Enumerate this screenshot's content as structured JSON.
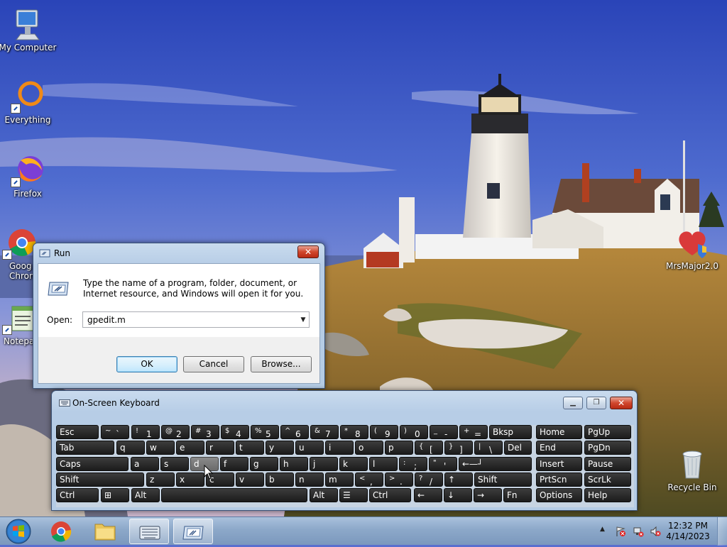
{
  "desktop": {
    "icons": [
      {
        "label": "My Computer"
      },
      {
        "label": "Everything"
      },
      {
        "label": "Firefox"
      },
      {
        "label": "Goog… Chrom…"
      },
      {
        "label": "Notepa…"
      },
      {
        "label": "MrsMajor2.0"
      },
      {
        "label": "Recycle Bin"
      }
    ]
  },
  "run_dialog": {
    "title": "Run",
    "description": "Type the name of a program, folder, document, or Internet resource, and Windows will open it for you.",
    "open_label": "Open:",
    "open_value": "gpedit.m",
    "ok_label": "OK",
    "cancel_label": "Cancel",
    "browse_label": "Browse..."
  },
  "osk": {
    "title": "On-Screen Keyboard",
    "rows": [
      [
        {
          "label": "Esc"
        },
        {
          "shift": "~",
          "main": "`"
        },
        {
          "shift": "!",
          "main": "1"
        },
        {
          "shift": "@",
          "main": "2"
        },
        {
          "shift": "#",
          "main": "3"
        },
        {
          "shift": "$",
          "main": "4"
        },
        {
          "shift": "%",
          "main": "5"
        },
        {
          "shift": "^",
          "main": "6"
        },
        {
          "shift": "&",
          "main": "7"
        },
        {
          "shift": "*",
          "main": "8"
        },
        {
          "shift": "(",
          "main": "9"
        },
        {
          "shift": ")",
          "main": "0"
        },
        {
          "shift": "_",
          "main": "-"
        },
        {
          "shift": "+",
          "main": "="
        },
        {
          "label": "Bksp"
        },
        {
          "label": "Home"
        },
        {
          "label": "PgUp"
        }
      ],
      [
        {
          "label": "Tab"
        },
        {
          "label": "q"
        },
        {
          "label": "w"
        },
        {
          "label": "e"
        },
        {
          "label": "r"
        },
        {
          "label": "t"
        },
        {
          "label": "y"
        },
        {
          "label": "u"
        },
        {
          "label": "i"
        },
        {
          "label": "o"
        },
        {
          "label": "p"
        },
        {
          "shift": "{",
          "main": "["
        },
        {
          "shift": "}",
          "main": "]"
        },
        {
          "shift": "|",
          "main": "\\"
        },
        {
          "label": "Del"
        },
        {
          "label": "End"
        },
        {
          "label": "PgDn"
        }
      ],
      [
        {
          "label": "Caps"
        },
        {
          "label": "a"
        },
        {
          "label": "s"
        },
        {
          "label": "d"
        },
        {
          "label": "f"
        },
        {
          "label": "g"
        },
        {
          "label": "h"
        },
        {
          "label": "j"
        },
        {
          "label": "k"
        },
        {
          "label": "l"
        },
        {
          "shift": ":",
          "main": ";"
        },
        {
          "shift": "\"",
          "main": "'"
        },
        {
          "label": "←—┘"
        },
        {
          "label": "Insert"
        },
        {
          "label": "Pause"
        }
      ],
      [
        {
          "label": "Shift"
        },
        {
          "label": "z"
        },
        {
          "label": "x"
        },
        {
          "label": "c"
        },
        {
          "label": "v"
        },
        {
          "label": "b"
        },
        {
          "label": "n"
        },
        {
          "label": "m"
        },
        {
          "shift": "<",
          "main": ","
        },
        {
          "shift": ">",
          "main": "."
        },
        {
          "shift": "?",
          "main": "/"
        },
        {
          "label": "↑"
        },
        {
          "label": "Shift"
        },
        {
          "label": "PrtScn"
        },
        {
          "label": "ScrLk"
        }
      ],
      [
        {
          "label": "Ctrl"
        },
        {
          "label": "⊞"
        },
        {
          "label": "Alt"
        },
        {
          "label": ""
        },
        {
          "label": "Alt"
        },
        {
          "label": "☰"
        },
        {
          "label": "Ctrl"
        },
        {
          "label": "←"
        },
        {
          "label": "↓"
        },
        {
          "label": "→"
        },
        {
          "label": "Fn"
        },
        {
          "label": "Options"
        },
        {
          "label": "Help"
        }
      ]
    ]
  },
  "taskbar": {
    "time": "12:32 PM",
    "date": "4/14/2023",
    "tray_arrow": "▲"
  },
  "colors": {
    "accent": "#3c7fb1",
    "key_face": "#1b1b1b",
    "taskbar": "#8ca8c9"
  }
}
